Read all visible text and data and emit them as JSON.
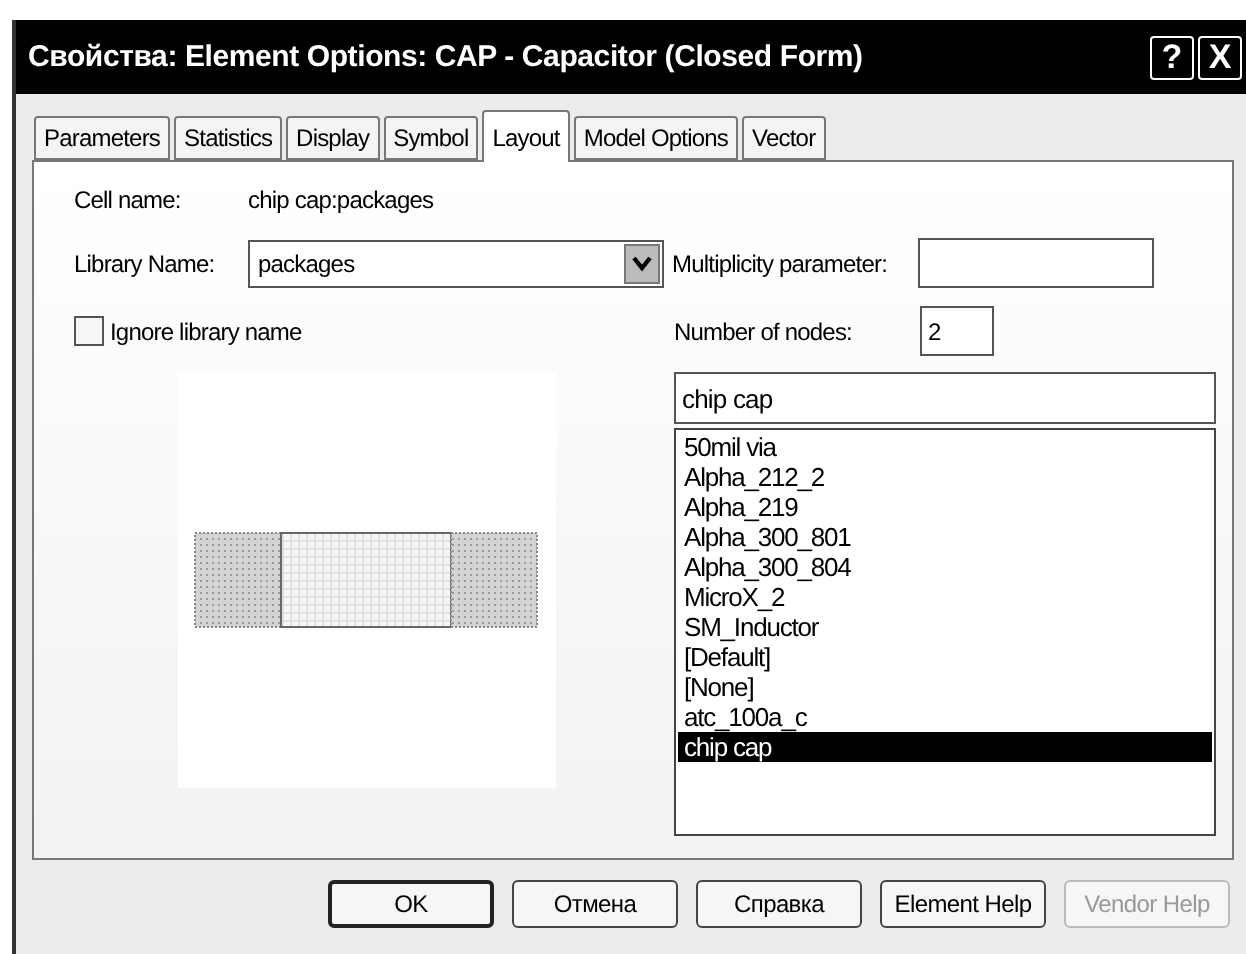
{
  "window": {
    "title": "Свойства: Element Options: CAP - Capacitor (Closed Form)",
    "help_button": "?",
    "close_button": "X"
  },
  "tabs": [
    {
      "label": "Parameters",
      "selected": false
    },
    {
      "label": "Statistics",
      "selected": false
    },
    {
      "label": "Display",
      "selected": false
    },
    {
      "label": "Symbol",
      "selected": false
    },
    {
      "label": "Layout",
      "selected": true
    },
    {
      "label": "Model Options",
      "selected": false
    },
    {
      "label": "Vector",
      "selected": false
    }
  ],
  "cell_name": {
    "label": "Cell name:",
    "value": "chip cap:packages"
  },
  "library_name": {
    "label": "Library Name:",
    "value": "packages"
  },
  "multiplicity": {
    "label": "Multiplicity parameter:"
  },
  "ignore_library": {
    "label": "Ignore library name",
    "checked": false
  },
  "nodes": {
    "label": "Number of nodes:",
    "value": "2"
  },
  "cell_search": {
    "value": "chip cap"
  },
  "cells": [
    {
      "label": "50mil via",
      "selected": false
    },
    {
      "label": "Alpha_212_2",
      "selected": false
    },
    {
      "label": "Alpha_219",
      "selected": false
    },
    {
      "label": "Alpha_300_801",
      "selected": false
    },
    {
      "label": "Alpha_300_804",
      "selected": false
    },
    {
      "label": "MicroX_2",
      "selected": false
    },
    {
      "label": "SM_Inductor",
      "selected": false
    },
    {
      "label": "[Default]",
      "selected": false
    },
    {
      "label": "[None]",
      "selected": false
    },
    {
      "label": "atc_100a_c",
      "selected": false
    },
    {
      "label": "chip cap",
      "selected": true
    }
  ],
  "buttons": [
    {
      "label": "OK",
      "disabled": false,
      "default": true
    },
    {
      "label": "Отмена",
      "disabled": false,
      "default": false
    },
    {
      "label": "Справка",
      "disabled": false,
      "default": false
    },
    {
      "label": "Element Help",
      "disabled": false,
      "default": false
    },
    {
      "label": "Vendor Help",
      "disabled": true,
      "default": false
    }
  ]
}
